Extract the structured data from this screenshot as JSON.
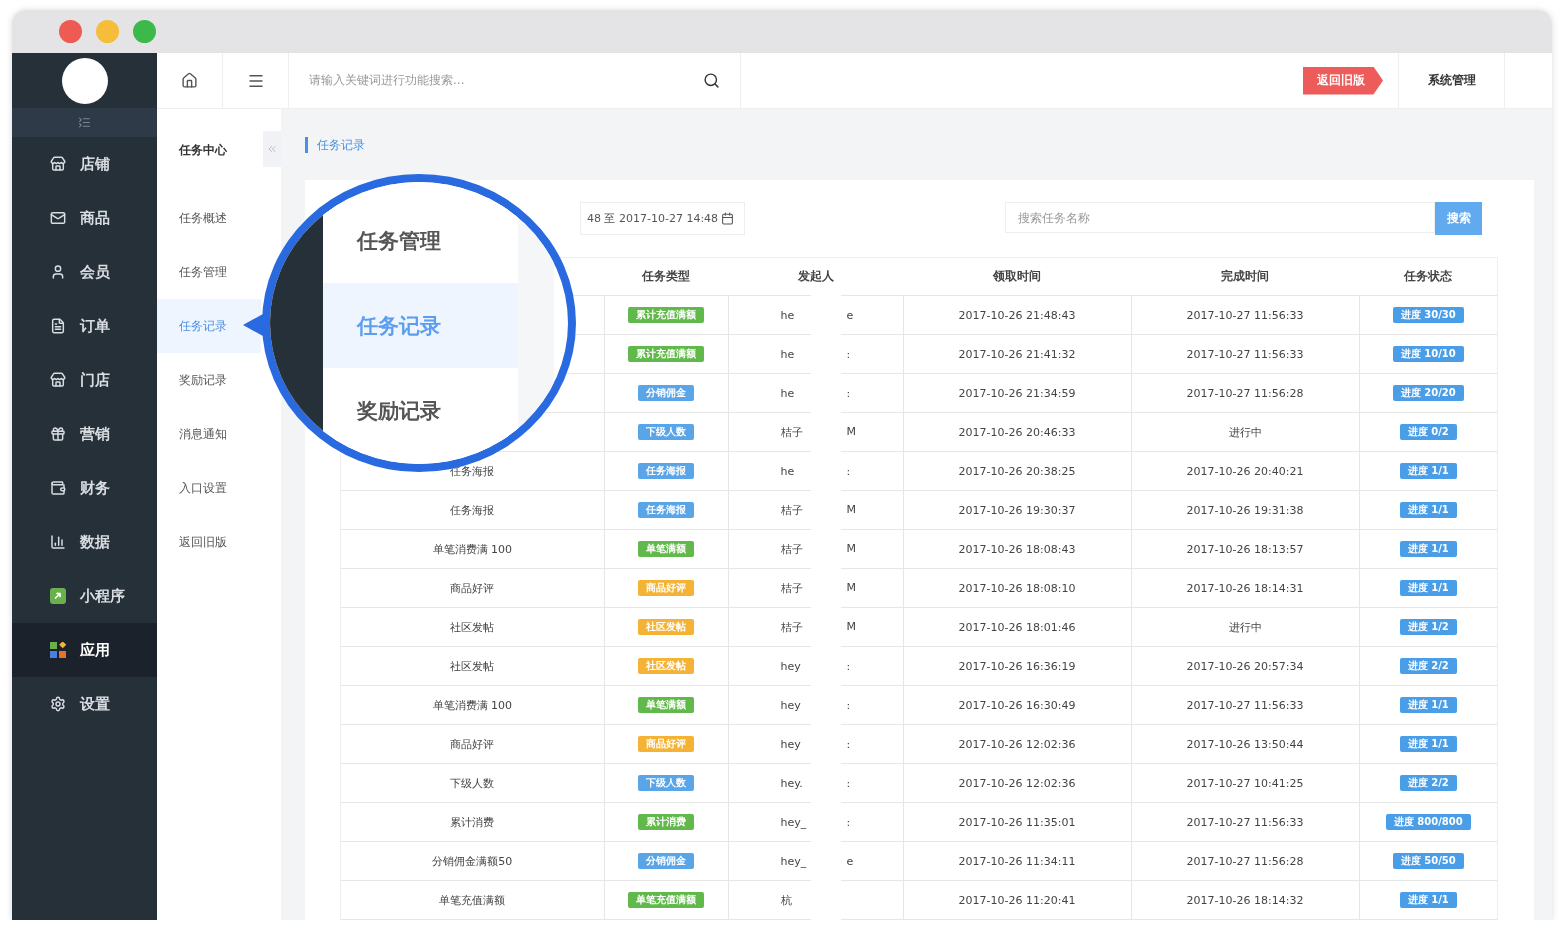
{
  "sidebar": {
    "items": [
      {
        "label": "店铺",
        "selected": false
      },
      {
        "label": "商品",
        "selected": false
      },
      {
        "label": "会员",
        "selected": false
      },
      {
        "label": "订单",
        "selected": false
      },
      {
        "label": "门店",
        "selected": false
      },
      {
        "label": "营销",
        "selected": false
      },
      {
        "label": "财务",
        "selected": false
      },
      {
        "label": "数据",
        "selected": false
      },
      {
        "label": "小程序",
        "selected": false
      },
      {
        "label": "应用",
        "selected": true
      },
      {
        "label": "设置",
        "selected": false
      }
    ]
  },
  "subnav": {
    "title": "任务中心",
    "items": [
      {
        "label": "任务概述",
        "selected": false
      },
      {
        "label": "任务管理",
        "selected": false
      },
      {
        "label": "任务记录",
        "selected": true
      },
      {
        "label": "奖励记录",
        "selected": false
      },
      {
        "label": "消息通知",
        "selected": false
      },
      {
        "label": "入口设置",
        "selected": false
      },
      {
        "label": "返回旧版",
        "selected": false
      }
    ]
  },
  "topbar": {
    "search_placeholder": "请输入关键词进行功能搜索...",
    "old_version_button": "返回旧版",
    "system_menu": "系统管理"
  },
  "breadcrumb": "任务记录",
  "filters": {
    "date_range": "48 至 2017-10-27 14:48",
    "search_placeholder": "搜索任务名称",
    "search_button": "搜索"
  },
  "table": {
    "columns": [
      "任务类型",
      "发起人",
      "领取时间",
      "完成时间",
      "任务状态"
    ],
    "rows": [
      {
        "type": "累计充值满额",
        "color": "#62b94b",
        "initiator": "he",
        "initiator_tail": "e",
        "received": "2017-10-26 21:48:43",
        "completed": "2017-10-27 11:56:33",
        "status": "进度 30/30"
      },
      {
        "type": "累计充值满额",
        "color": "#62b94b",
        "initiator": "he",
        "initiator_tail": ":",
        "received": "2017-10-26 21:41:32",
        "completed": "2017-10-27 11:56:33",
        "status": "进度 10/10"
      },
      {
        "type": "分销佣金",
        "color": "#5aa5e8",
        "initiator": "he",
        "initiator_tail": ":",
        "received": "2017-10-26 21:34:59",
        "completed": "2017-10-27 11:56:28",
        "status": "进度 20/20"
      },
      {
        "type": "下级人数",
        "color": "#5aa5e8",
        "initiator": "桔子",
        "initiator_tail": "M",
        "received": "2017-10-26 20:46:33",
        "completed": "进行中",
        "status": "进度 0/2"
      },
      {
        "name": "任务海报",
        "type": "任务海报",
        "color": "#5aa5e8",
        "initiator": "he",
        "initiator_tail": ":",
        "received": "2017-10-26 20:38:25",
        "completed": "2017-10-26 20:40:21",
        "status": "进度 1/1"
      },
      {
        "name": "任务海报",
        "type": "任务海报",
        "color": "#5aa5e8",
        "initiator": "桔子",
        "initiator_tail": "M",
        "received": "2017-10-26 19:30:37",
        "completed": "2017-10-26 19:31:38",
        "status": "进度 1/1"
      },
      {
        "name": "单笔消费满 100",
        "type": "单笔满额",
        "color": "#62b94b",
        "initiator": "桔子",
        "initiator_tail": "M",
        "received": "2017-10-26 18:08:43",
        "completed": "2017-10-26 18:13:57",
        "status": "进度 1/1"
      },
      {
        "name": "商品好评",
        "type": "商品好评",
        "color": "#f5b335",
        "initiator": "桔子",
        "initiator_tail": "M",
        "received": "2017-10-26 18:08:10",
        "completed": "2017-10-26 18:14:31",
        "status": "进度 1/1"
      },
      {
        "name": "社区发帖",
        "type": "社区发帖",
        "color": "#f5b335",
        "initiator": "桔子",
        "initiator_tail": "M",
        "received": "2017-10-26 18:01:46",
        "completed": "进行中",
        "status": "进度 1/2"
      },
      {
        "name": "社区发帖",
        "type": "社区发帖",
        "color": "#f5b335",
        "initiator": "hey",
        "initiator_tail": ":",
        "received": "2017-10-26 16:36:19",
        "completed": "2017-10-26 20:57:34",
        "status": "进度 2/2"
      },
      {
        "name": "单笔消费满 100",
        "type": "单笔满额",
        "color": "#62b94b",
        "initiator": "hey",
        "initiator_tail": ":",
        "received": "2017-10-26 16:30:49",
        "completed": "2017-10-27 11:56:33",
        "status": "进度 1/1"
      },
      {
        "name": "商品好评",
        "type": "商品好评",
        "color": "#f5b335",
        "initiator": "hey",
        "initiator_tail": ":",
        "received": "2017-10-26 12:02:36",
        "completed": "2017-10-26 13:50:44",
        "status": "进度 1/1"
      },
      {
        "name": "下级人数",
        "type": "下级人数",
        "color": "#5aa5e8",
        "initiator": "hey.",
        "initiator_tail": ":",
        "received": "2017-10-26 12:02:36",
        "completed": "2017-10-27 10:41:25",
        "status": "进度 2/2"
      },
      {
        "name": "累计消费",
        "type": "累计消费",
        "color": "#62b94b",
        "initiator": "hey_",
        "initiator_tail": ":",
        "received": "2017-10-26 11:35:01",
        "completed": "2017-10-27 11:56:33",
        "status": "进度 800/800"
      },
      {
        "name": "分销佣金满额50",
        "type": "分销佣金",
        "color": "#5aa5e8",
        "initiator": "hey_",
        "initiator_tail": "e",
        "received": "2017-10-26 11:34:11",
        "completed": "2017-10-27 11:56:28",
        "status": "进度 50/50"
      },
      {
        "name": "单笔充值满额",
        "type": "单笔充值满额",
        "color": "#62b94b",
        "initiator": "杭",
        "received": "2017-10-26 11:20:41",
        "completed": "2017-10-26 18:14:32",
        "status": "进度 1/1"
      }
    ]
  },
  "magnifier": {
    "items": [
      {
        "label": "任务管理",
        "selected": false
      },
      {
        "label": "任务记录",
        "selected": true
      },
      {
        "label": "奖励记录",
        "selected": false
      }
    ]
  }
}
